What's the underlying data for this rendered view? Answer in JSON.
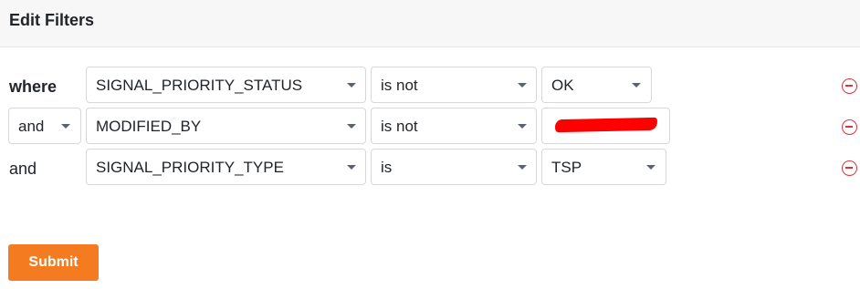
{
  "header": {
    "title": "Edit Filters"
  },
  "filters": [
    {
      "conjunction": "where",
      "field": "SIGNAL_PRIORITY_STATUS",
      "operator": "is not",
      "value": "OK"
    },
    {
      "conjunction": "and",
      "field": "MODIFIED_BY",
      "operator": "is not",
      "value": "",
      "value_redacted": true
    },
    {
      "conjunction": "and",
      "field": "SIGNAL_PRIORITY_TYPE",
      "operator": "is",
      "value": "TSP"
    }
  ],
  "submit_label": "Submit",
  "colors": {
    "accent": "#f57b20",
    "remove_icon": "#d9353f",
    "border": "#d6d8dc",
    "header_bg": "#f7f7f8"
  },
  "icons": {
    "dropdown": "chevron-down-icon",
    "remove": "remove-circle-icon"
  }
}
